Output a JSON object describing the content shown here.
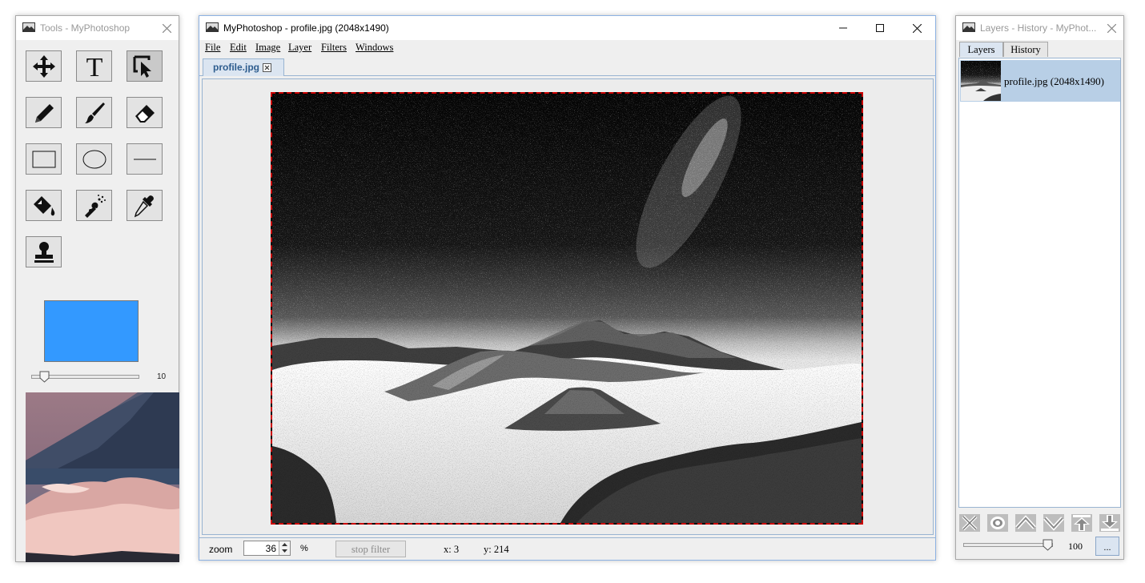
{
  "colors": {
    "primary_color": "#3399ff",
    "selection_border": "#cc0000"
  },
  "tools_window": {
    "title": "Tools - MyPhotoshop",
    "tools": [
      {
        "icon": "move-icon",
        "active": false
      },
      {
        "icon": "text-tool-icon",
        "active": false
      },
      {
        "icon": "selection-tool-icon",
        "active": true
      },
      {
        "icon": "pencil-icon",
        "active": false
      },
      {
        "icon": "brush-icon",
        "active": false
      },
      {
        "icon": "eraser-icon",
        "active": false
      },
      {
        "icon": "rectangle-icon",
        "active": false
      },
      {
        "icon": "ellipse-icon",
        "active": false
      },
      {
        "icon": "line-icon",
        "active": false
      },
      {
        "icon": "paint-bucket-icon",
        "active": false
      },
      {
        "icon": "spray-icon",
        "active": false
      },
      {
        "icon": "eyedropper-icon",
        "active": false
      },
      {
        "icon": "stamp-icon",
        "active": false
      }
    ],
    "brush_size_value": "10",
    "brush_size_fraction": 0.08
  },
  "main_window": {
    "title": "MyPhotoshop - profile.jpg (2048x1490)",
    "menu": [
      "File",
      "Edit",
      "Image",
      "Layer",
      "Filters",
      "Windows"
    ],
    "tab_label": "profile.jpg",
    "status": {
      "zoom_label": "zoom",
      "zoom_value": "36",
      "zoom_unit": "%",
      "stop_filter_label": "stop filter",
      "x_readout": "x: 3",
      "y_readout": "y: 214"
    }
  },
  "layers_window": {
    "title": "Layers - History - MyPhot...",
    "tabs": [
      "Layers",
      "History"
    ],
    "active_tab": "Layers",
    "layers": [
      {
        "name": "profile.jpg (2048x1490)",
        "selected": true
      }
    ],
    "buttons": [
      "delete-layer-icon",
      "toggle-visibility-icon",
      "move-up-icon",
      "move-down-icon",
      "move-to-top-icon",
      "move-to-bottom-icon"
    ],
    "opacity_value": "100",
    "opacity_fraction": 1.0,
    "more_button_label": "..."
  }
}
